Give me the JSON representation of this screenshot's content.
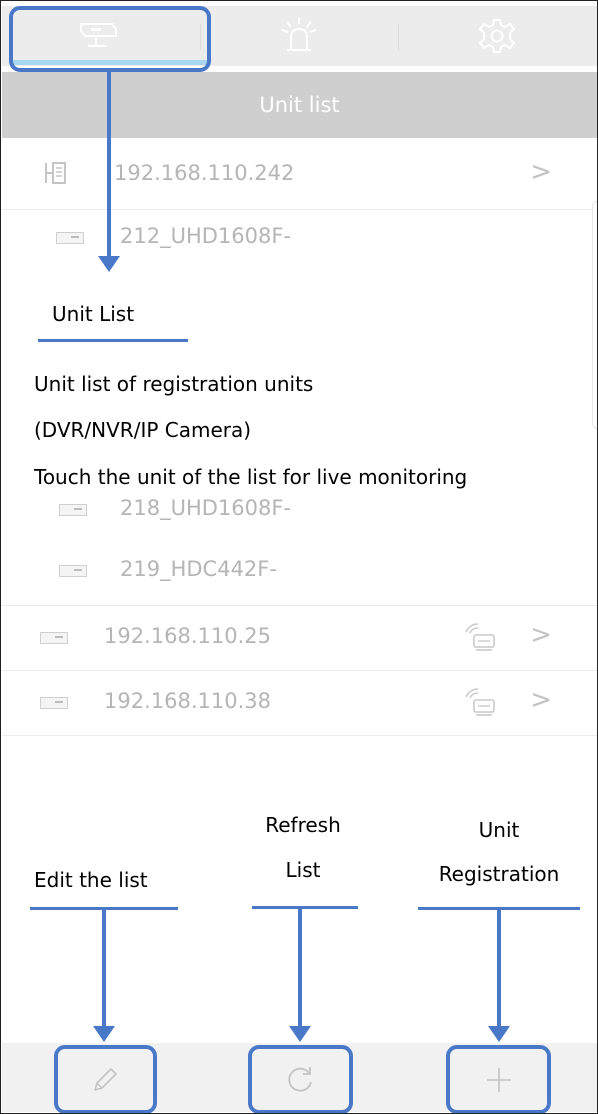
{
  "header": {
    "tabs": [
      {
        "icon": "camera-icon"
      },
      {
        "icon": "alarm-icon"
      },
      {
        "icon": "gear-icon"
      }
    ],
    "title": "Unit list"
  },
  "unit_list": [
    {
      "label": "192.168.110.242",
      "icon": "building-icon",
      "chevron": ">"
    },
    {
      "label": "212_UHD1608F-",
      "icon": "dvr-icon"
    },
    {
      "label": "218_UHD1608F-",
      "icon": "dvr-icon"
    },
    {
      "label": "219_HDC442F-",
      "icon": "dvr-icon"
    },
    {
      "label": "192.168.110.25",
      "icon": "dvr-icon",
      "status_icon": "network-icon",
      "chevron": ">"
    },
    {
      "label": "192.168.110.38",
      "icon": "dvr-icon",
      "status_icon": "network-icon",
      "chevron": ">"
    }
  ],
  "annotations": {
    "unit_list_title": "Unit List",
    "desc_line1": "Unit list of registration units",
    "desc_line2": "(DVR/NVR/IP Camera)",
    "desc_line3": "Touch the unit of the list for live monitoring",
    "edit_label": "Edit the list",
    "refresh_line1": "Refresh",
    "refresh_line2": "List",
    "register_line1": "Unit",
    "register_line2": "Registration"
  },
  "bottom_bar": {
    "buttons": [
      {
        "icon": "pencil-icon"
      },
      {
        "icon": "refresh-icon"
      },
      {
        "icon": "plus-icon"
      }
    ]
  },
  "colors": {
    "annotation_blue": "#4a78c8",
    "title_bar": "#cfcfcf",
    "tab_underline": "#a9d6ef",
    "muted_text": "#b5b5b5"
  }
}
